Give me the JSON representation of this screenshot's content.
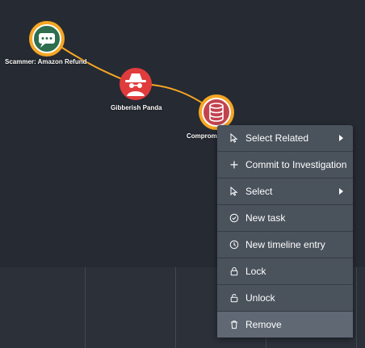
{
  "graph": {
    "nodes": [
      {
        "label": "Scammer: Amazon Refund",
        "icon": "chat-bubble-icon",
        "ring_color": "#f5a623",
        "fill_color": "#2e6e4e"
      },
      {
        "label": "Gibberish Panda",
        "icon": "spy-icon",
        "fill_color": "#e03c3c"
      },
      {
        "label": "Compromi",
        "icon": "database-icon",
        "ring_color": "#f5a623",
        "fill_color": "#c2434e"
      }
    ],
    "edge_color": "#f5a623"
  },
  "context_menu": {
    "items": [
      {
        "label": "Select Related",
        "icon": "cursor-icon",
        "has_submenu": true
      },
      {
        "label": "Commit to Investigation",
        "icon": "plus-icon",
        "has_submenu": false
      },
      {
        "label": "Select",
        "icon": "cursor-icon",
        "has_submenu": true
      },
      {
        "label": "New task",
        "icon": "check-circle-icon",
        "has_submenu": false
      },
      {
        "label": "New timeline entry",
        "icon": "clock-icon",
        "has_submenu": false
      },
      {
        "label": "Lock",
        "icon": "lock-icon",
        "has_submenu": false
      },
      {
        "label": "Unlock",
        "icon": "unlock-icon",
        "has_submenu": false
      },
      {
        "label": "Remove",
        "icon": "trash-icon",
        "has_submenu": false,
        "highlighted": true
      }
    ]
  },
  "colors": {
    "background": "#262a33",
    "menu_background": "#4a525c",
    "menu_highlight": "#5f6873"
  }
}
